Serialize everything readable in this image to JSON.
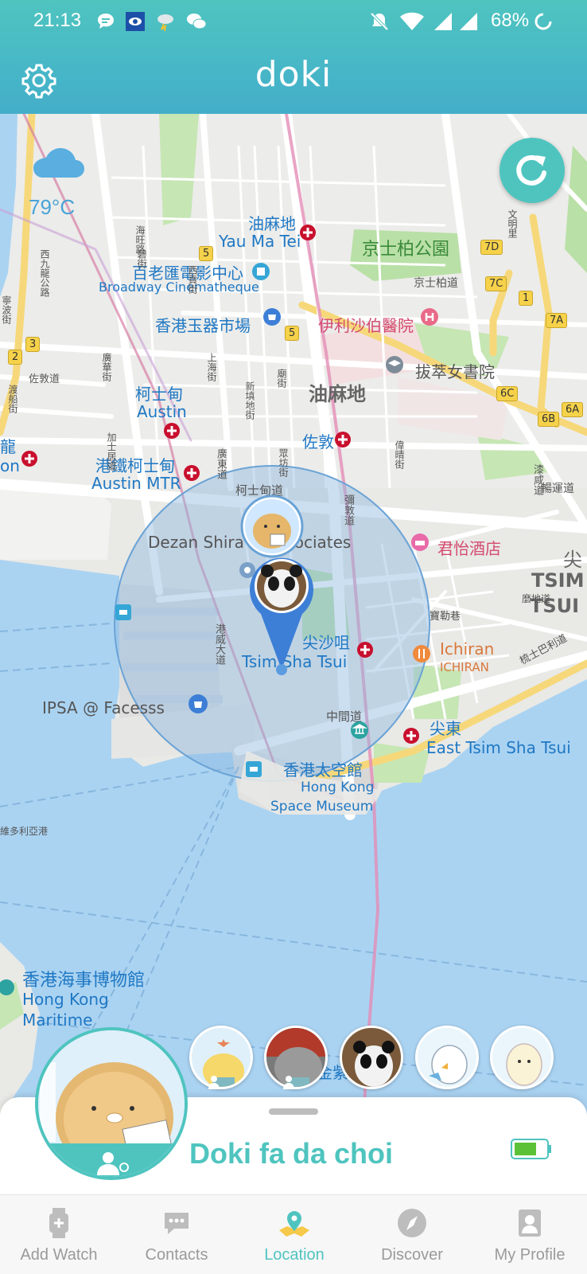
{
  "status_bar": {
    "time": "21:13",
    "battery_percent": "68%",
    "icons": [
      "message-bubble-icon",
      "blue-app-icon",
      "weather-storm-icon",
      "wechat-icon",
      "mute-icon",
      "wifi-icon",
      "signal-icon",
      "signal-icon",
      "battery-ring-icon"
    ]
  },
  "header": {
    "title": "doki",
    "settings_icon": "gear-icon"
  },
  "weather": {
    "icon": "cloud-icon",
    "temperature": "79°C"
  },
  "map": {
    "refresh_icon": "refresh-icon",
    "labels": {
      "yau_ma_tei_zh": "油麻地",
      "yau_ma_tei_en": "Yau Ma Tei",
      "cinematheque_zh": "百老匯電影中心",
      "cinematheque_en": "Broadway Cinematheque",
      "jade_market": "香港玉器市場",
      "elizabeth_hosp": "伊利沙伯醫院",
      "king_george_park": "京士柏公園",
      "king_george_rd": "京士柏道",
      "pui_ching": "拔萃女書院",
      "austin_zh": "柯士甸",
      "austin_en": "Austin",
      "yau_ma_tei_district": "油麻地",
      "jordan": "佐敦",
      "austin_mtr_zh": "港鐵柯士甸",
      "austin_mtr_en": "Austin MTR",
      "austin_rd": "柯士甸道",
      "dezan": "Dezan Shira & Associates",
      "hyatt": "君怡酒店",
      "tst_zh": "尖沙咀",
      "tst_en": "Tsim Sha Tsui",
      "tsim_east_big": "尖",
      "tsim_en_big_1": "TSIM",
      "tsim_en_big_2": "TSUI E",
      "ichiran_en": "Ichiran",
      "ichiran_sub": "ICHIRAN",
      "ipsa": "IPSA @ Facesss",
      "middle_rd": "中間道",
      "east_tst_zh": "尖東",
      "east_tst_en": "East Tsim Sha Tsui",
      "space_museum_zh": "香港太空館",
      "space_museum_en1": "Hong Kong",
      "space_museum_en2": "Space Museum",
      "maritime_zh": "香港海事博物館",
      "maritime_en1": "Hong Kong",
      "maritime_en2": "Maritime",
      "jordan_left": "龍",
      "jordan_left2": "on",
      "golden_bauhinia": "金紫荊廣場",
      "road_canton": "廣東道",
      "road_nathan": "彌敦道",
      "road_haiphong": "寶勒巷",
      "road_chatham": "漆咸道",
      "road_gascoigne": "加士居道",
      "road_harbour": "港威大道",
      "road_kingwah": "暢運道",
      "road_mody": "麼地道",
      "road_shanghai": "上海街",
      "road_ferry": "渡船街",
      "road_jordan": "佐敦道",
      "road_kwong_wa": "廣華街",
      "road_tst_e": "梳士巴利道",
      "road_west_kowloon": "西九龍公路",
      "road_hoi_wang": "海旺路",
      "road_victoria": "維多利亞港",
      "road_public_square": "眾坊街",
      "road_saigon": "西貢街",
      "road_temple": "廟街",
      "road_reclamation": "新填地街",
      "road_pitt": "碧街",
      "road_man_ming": "文明里",
      "road_wai_ching": "偉晴街",
      "road_ning_po": "寧波街"
    },
    "route_badges": [
      "5",
      "5",
      "2",
      "3",
      "7D",
      "7C",
      "1",
      "7A",
      "6C",
      "6B",
      "6A"
    ]
  },
  "devices": {
    "avatars": [
      "chick-avatar",
      "cat-avatar",
      "panda-avatar",
      "bird-avatar",
      "ghost-avatar"
    ],
    "selected_name": "Doki fa da choi",
    "battery_level": 0.7
  },
  "tabs": [
    {
      "label": "Add Watch",
      "icon": "watch-icon"
    },
    {
      "label": "Contacts",
      "icon": "chat-bubble-icon"
    },
    {
      "label": "Location",
      "icon": "location-pin-icon",
      "active": true
    },
    {
      "label": "Discover",
      "icon": "compass-icon"
    },
    {
      "label": "My Profile",
      "icon": "profile-icon"
    }
  ],
  "colors": {
    "accent": "#4fc4bf",
    "water": "#aad3f2",
    "land": "#e9e9e6",
    "park": "#b9e0a6",
    "radius_fill": "#8fb9e0"
  }
}
